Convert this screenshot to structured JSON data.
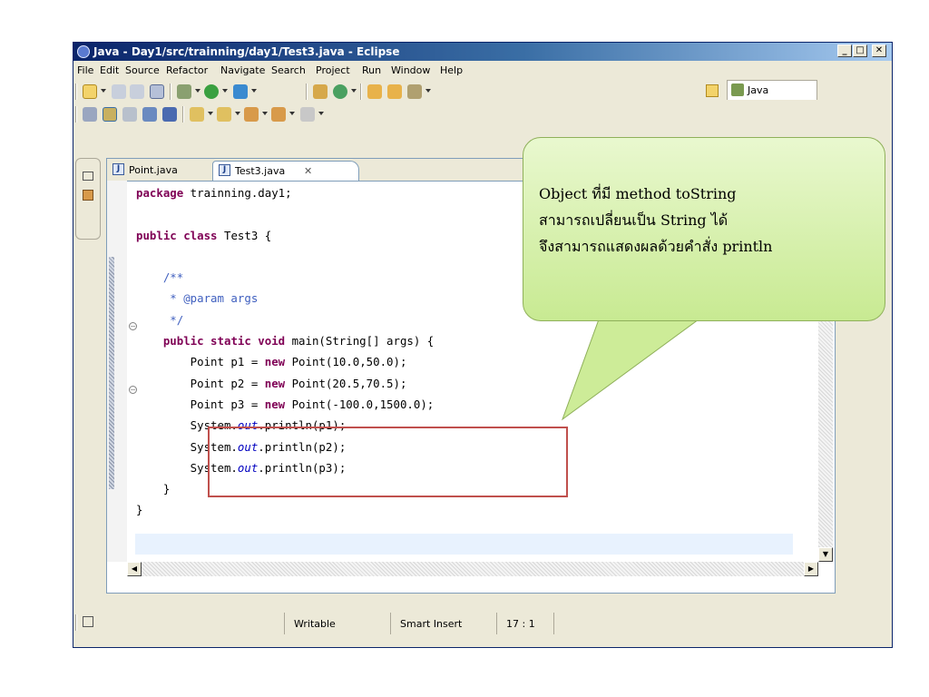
{
  "window": {
    "title": "Java - Day1/src/trainning/day1/Test3.java - Eclipse",
    "min_label": "_",
    "max_label": "□",
    "close_label": "✕"
  },
  "menu": [
    "File",
    "Edit",
    "Source",
    "Refactor",
    "Navigate",
    "Search",
    "Project",
    "Run",
    "Window",
    "Help"
  ],
  "perspective": {
    "label": "Java"
  },
  "tabs": [
    {
      "label": "Point.java"
    },
    {
      "label": "Test3.java",
      "close": "✕"
    }
  ],
  "code_lines": [
    "package trainning.day1;",
    "",
    "public class Test3 {",
    "",
    "    /**",
    "     * @param args",
    "     */",
    "    public static void main(String[] args) {",
    "        Point p1 = new Point(10.0,50.0);",
    "        Point p2 = new Point(20.5,70.5);",
    "        Point p3 = new Point(-100.0,1500.0);",
    "        System.out.println(p1);",
    "        System.out.println(p2);",
    "        System.out.println(p3);",
    "    }",
    "}"
  ],
  "callout": {
    "lines": [
      "Object ที่มี method  toString",
      "สามารถเปลี่ยนเป็น String ได้",
      "จึงสามารถแสดงผลด้วยคำสั่ง  println"
    ]
  },
  "status": {
    "writable": "Writable",
    "insert_mode": "Smart Insert",
    "position": "17 : 1"
  },
  "colors": {
    "keyword": "#7f0055",
    "comment": "#3f5fbf",
    "static_field": "#0000c0",
    "callout_fill": "#d8f0b0",
    "highlight_box": "#c0504d"
  }
}
